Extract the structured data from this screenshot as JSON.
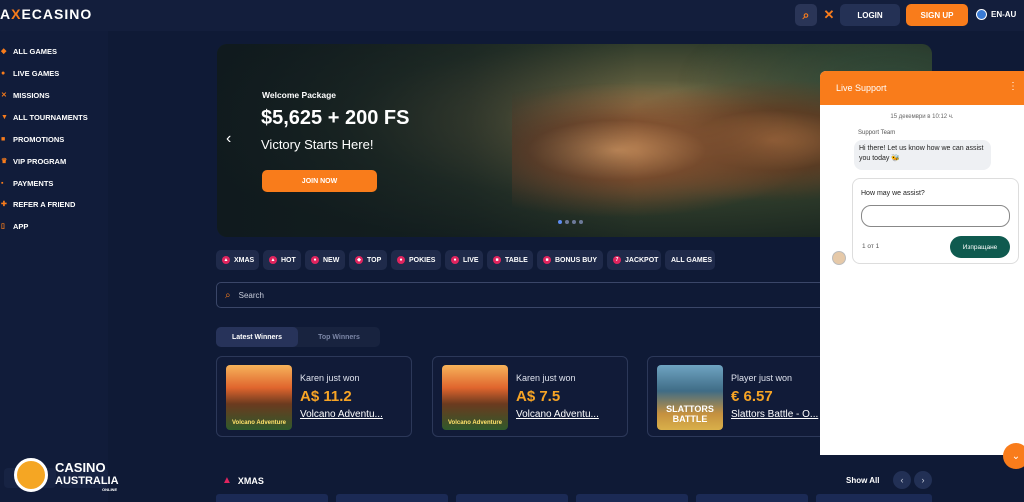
{
  "header": {
    "logo_prefix": "A",
    "logo_x": "X",
    "logo_suffix": "ECASINO",
    "login": "LOGIN",
    "signup": "SIGN UP",
    "language": "EN-AU"
  },
  "sidebar": {
    "items": [
      {
        "label": "ALL GAMES",
        "icon": "grid-icon"
      },
      {
        "label": "LIVE GAMES",
        "icon": "live-icon"
      },
      {
        "label": "MISSIONS",
        "icon": "swords-icon"
      },
      {
        "label": "ALL TOURNAMENTS",
        "icon": "trophy-icon"
      },
      {
        "label": "PROMOTIONS",
        "icon": "gift-icon"
      },
      {
        "label": "VIP PROGRAM",
        "icon": "crown-icon"
      },
      {
        "label": "PAYMENTS",
        "icon": "wallet-icon"
      },
      {
        "label": "REFER A FRIEND",
        "icon": "user-plus-icon"
      },
      {
        "label": "APP",
        "icon": "phone-icon"
      }
    ]
  },
  "banner": {
    "subtitle": "Welcome Package",
    "title": "$5,625 + 200 FS",
    "tagline": "Victory Starts Here!",
    "cta": "JOIN NOW",
    "slide_count": 4,
    "active_slide": 1
  },
  "filters": [
    {
      "label": "XMAS",
      "icon": "tree-icon"
    },
    {
      "label": "HOT",
      "icon": "fire-icon"
    },
    {
      "label": "NEW",
      "icon": "new-icon"
    },
    {
      "label": "TOP",
      "icon": "top-icon"
    },
    {
      "label": "POKIES",
      "icon": "cherry-icon"
    },
    {
      "label": "LIVE",
      "icon": "live-icon"
    },
    {
      "label": "TABLE",
      "icon": "table-icon"
    },
    {
      "label": "BONUS BUY",
      "icon": "bonus-icon"
    },
    {
      "label": "JACKPOT",
      "icon": "seven-icon"
    },
    {
      "label": "ALL GAMES",
      "icon": ""
    }
  ],
  "search": {
    "placeholder": "Search"
  },
  "winners": {
    "tabs": [
      "Latest Winners",
      "Top Winners"
    ],
    "active_tab": 0,
    "cards": [
      {
        "who": "Karen just won",
        "amount": "A$ 11.2",
        "game": "Volcano Adventu...",
        "thumb_text": "Volcano Adventure"
      },
      {
        "who": "Karen just won",
        "amount": "A$ 7.5",
        "game": "Volcano Adventu...",
        "thumb_text": "Volcano Adventure"
      },
      {
        "who": "Player just won",
        "amount": "€ 6.57",
        "game": "Slattors Battle - O...",
        "thumb_text": "SLATTORS BATTLE"
      }
    ]
  },
  "section": {
    "title": "XMAS",
    "show_all": "Show All"
  },
  "badge": {
    "line1": "CASINO",
    "line2": "AUSTRALIA",
    "line3": "ONLINE"
  },
  "support": {
    "title": "Live Support",
    "date": "15 декември в 10:12 ч.",
    "from": "Support Team",
    "message": "Hi there! Let us know how we can assist you today 🐝",
    "question": "How may we assist?",
    "page": "1 от 1",
    "send": "Изпращане"
  },
  "colors": {
    "accent": "#f97c1b",
    "bg": "#0f1a36",
    "panel": "#111b38",
    "send": "#0f5a4f"
  }
}
